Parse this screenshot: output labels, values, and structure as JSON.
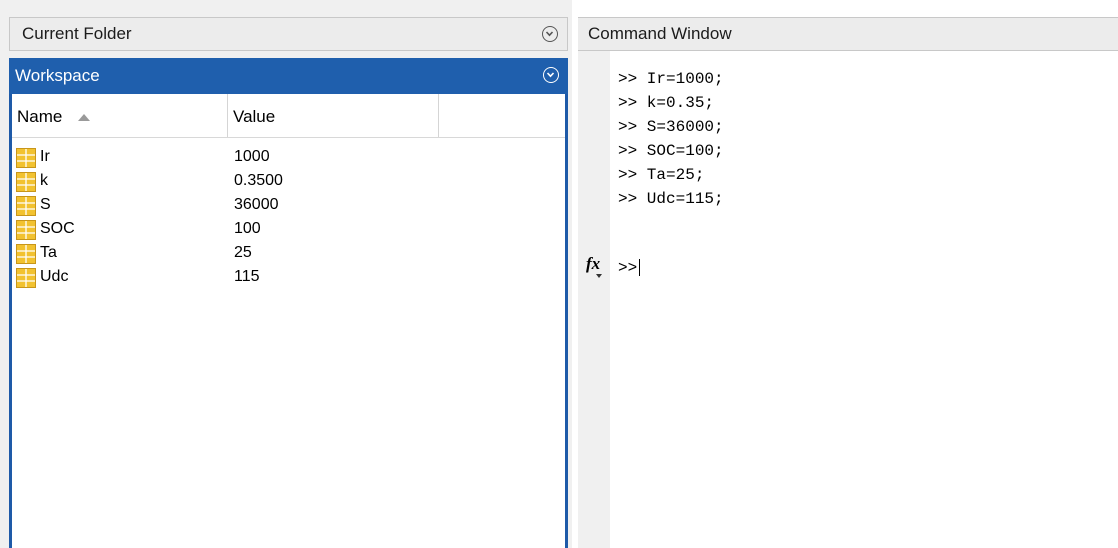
{
  "current_folder": {
    "title": "Current Folder",
    "collapse_icon": "chevron-down-circle-icon"
  },
  "workspace": {
    "title": "Workspace",
    "collapse_icon": "chevron-down-circle-icon",
    "columns": [
      "Name",
      "Value"
    ],
    "sort_indicator": "sort-ascending-icon",
    "variables": [
      {
        "name": "Ir",
        "value": "1000"
      },
      {
        "name": "k",
        "value": "0.3500"
      },
      {
        "name": "S",
        "value": "36000"
      },
      {
        "name": "SOC",
        "value": "100"
      },
      {
        "name": "Ta",
        "value": "25"
      },
      {
        "name": "Udc",
        "value": "115"
      }
    ]
  },
  "command_window": {
    "title": "Command Window",
    "lines": [
      ">> Ir=1000;",
      ">> k=0.35;",
      ">> S=36000;",
      ">> SOC=100;",
      ">> Ta=25;",
      ">> Udc=115;"
    ],
    "prompt": ">>",
    "fx_label": "fx"
  },
  "colors": {
    "workspace_header": "#1f5fad",
    "variable_icon": "#f2c230",
    "panel_background": "#f0f0f0"
  }
}
